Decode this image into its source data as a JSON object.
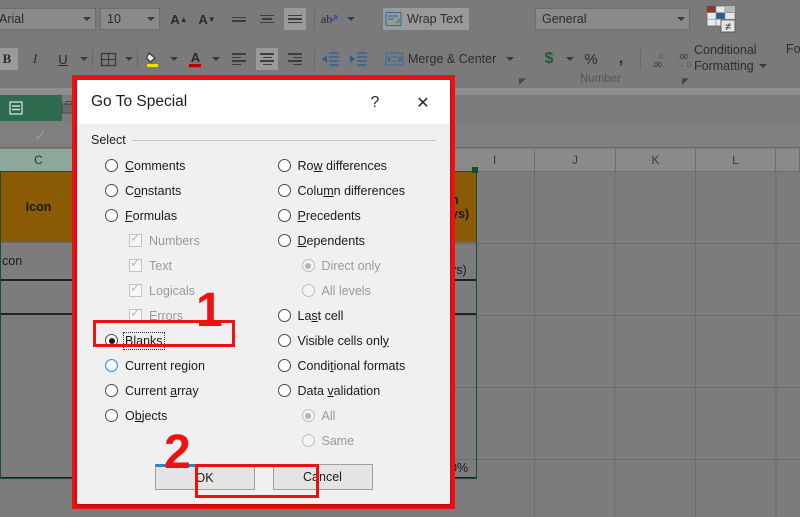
{
  "app": {
    "ribbon": {
      "font_name": "Arial",
      "font_size": "10",
      "grow_font": "A",
      "shrink_font": "A",
      "bold": "B",
      "italic": "I",
      "underline": "U",
      "wrap_text": "Wrap Text",
      "merge_center": "Merge & Center",
      "number_format": "General",
      "currency": "$",
      "percent": "%",
      "comma": ",",
      "increase_decimal": ".00",
      "decrease_decimal": ".00",
      "conditional_formatting": "Conditional\nFormatting",
      "conditional_formatting_l1": "Conditional",
      "conditional_formatting_l2": "Formatting",
      "format_as_table_partial": "Fo",
      "group_font": "",
      "group_alignment": "",
      "group_number": "Number"
    },
    "sheet": {
      "columns": [
        "C",
        "I",
        "J",
        "K",
        "L"
      ],
      "cells": [
        {
          "text": "Icon"
        },
        {
          "text": "con"
        },
        {
          "text": "h"
        },
        {
          "text": "ys)"
        },
        {
          "text": "ys)"
        },
        {
          "text": "0%"
        }
      ]
    }
  },
  "dialog": {
    "title": "Go To Special",
    "help_icon": "?",
    "close_icon": "✕",
    "group_label": "Select",
    "left_options": [
      {
        "label": "Comments",
        "accel": "C",
        "type": "radio",
        "state": "normal"
      },
      {
        "label": "Constants",
        "accel": "o",
        "type": "radio",
        "state": "normal"
      },
      {
        "label": "Formulas",
        "accel": "F",
        "type": "radio",
        "state": "normal"
      },
      {
        "label": "Numbers",
        "accel": "",
        "type": "checkbox",
        "state": "disabled-checked",
        "sub": true
      },
      {
        "label": "Text",
        "accel": "",
        "type": "checkbox",
        "state": "disabled-checked",
        "sub": true
      },
      {
        "label": "Logicals",
        "accel": "",
        "type": "checkbox",
        "state": "disabled-checked",
        "sub": true
      },
      {
        "label": "Errors",
        "accel": "",
        "type": "checkbox",
        "state": "disabled-checked",
        "sub": true
      },
      {
        "label": "Blanks",
        "accel": "k",
        "type": "radio",
        "state": "checked-focus"
      },
      {
        "label": "Current region",
        "accel": "g",
        "type": "radio",
        "state": "hover"
      },
      {
        "label": "Current array",
        "accel": "a",
        "type": "radio",
        "state": "normal"
      },
      {
        "label": "Objects",
        "accel": "b",
        "type": "radio",
        "state": "normal"
      }
    ],
    "right_options": [
      {
        "label": "Row differences",
        "accel": "w",
        "type": "radio",
        "state": "normal"
      },
      {
        "label": "Column differences",
        "accel": "m",
        "type": "radio",
        "state": "normal"
      },
      {
        "label": "Precedents",
        "accel": "P",
        "type": "radio",
        "state": "normal"
      },
      {
        "label": "Dependents",
        "accel": "D",
        "type": "radio",
        "state": "normal"
      },
      {
        "label": "Direct only",
        "accel": "",
        "type": "radio",
        "state": "disabled-checked",
        "sub": true
      },
      {
        "label": "All levels",
        "accel": "",
        "type": "radio",
        "state": "disabled",
        "sub": true
      },
      {
        "label": "Last cell",
        "accel": "s",
        "type": "radio",
        "state": "normal"
      },
      {
        "label": "Visible cells only",
        "accel": "y",
        "type": "radio",
        "state": "normal"
      },
      {
        "label": "Conditional formats",
        "accel": "t",
        "type": "radio",
        "state": "normal"
      },
      {
        "label": "Data validation",
        "accel": "v",
        "type": "radio",
        "state": "normal"
      },
      {
        "label": "All",
        "accel": "",
        "type": "radio",
        "state": "disabled-checked",
        "sub": true
      },
      {
        "label": "Same",
        "accel": "",
        "type": "radio",
        "state": "disabled",
        "sub": true
      }
    ],
    "ok_label": "OK",
    "cancel_label": "Cancel"
  },
  "annotations": {
    "step_one": "1",
    "step_two": "2",
    "color": "#ee1111"
  }
}
